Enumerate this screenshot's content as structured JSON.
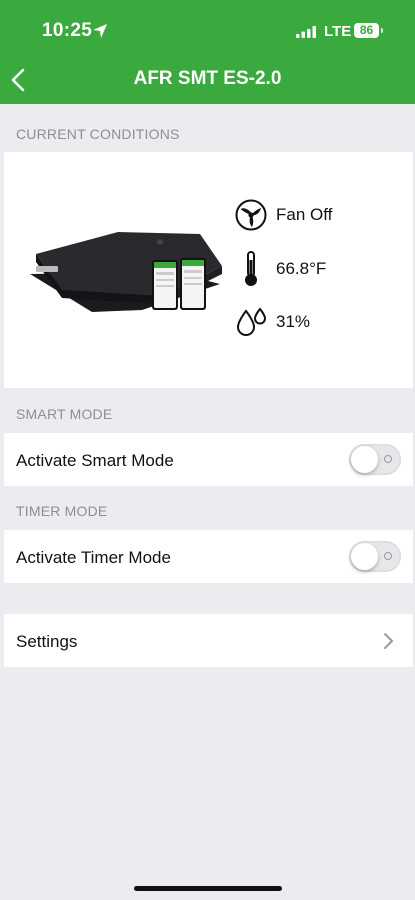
{
  "status_bar": {
    "time": "10:25",
    "network": "LTE",
    "battery": "86"
  },
  "nav": {
    "title": "AFR SMT ES-2.0"
  },
  "current_conditions": {
    "header": "CURRENT CONDITIONS",
    "fan_status": "Fan Off",
    "temperature": "66.8°F",
    "humidity": "31%"
  },
  "smart_mode": {
    "header": "SMART MODE",
    "label": "Activate Smart Mode",
    "enabled": false
  },
  "timer_mode": {
    "header": "TIMER MODE",
    "label": "Activate Timer Mode",
    "enabled": false
  },
  "settings": {
    "label": "Settings"
  },
  "colors": {
    "accent": "#3aaa3f",
    "background": "#ebebf0"
  }
}
